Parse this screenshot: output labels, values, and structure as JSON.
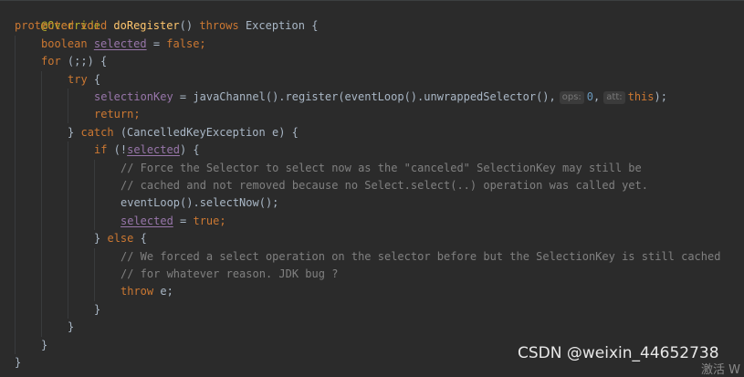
{
  "code": {
    "annotation": "@Override",
    "kw_protected": "protected",
    "kw_void": "void",
    "method_name": "doRegister",
    "paren_open_close": "()",
    "kw_throws": "throws",
    "exception_type": "Exception",
    "brace_open": "{",
    "kw_boolean": "boolean",
    "var_selected": "selected",
    "eq": " = ",
    "kw_false": "false",
    "semi": ";",
    "kw_for": "for",
    "for_header": " (;;) {",
    "kw_try": "try",
    "field_selectionKey": "selectionKey",
    "register_call": "javaChannel().register(eventLoop().unwrappedSelector(),",
    "hint_ops": "ops:",
    "num_zero": "0",
    "comma": ",",
    "hint_att": "att:",
    "kw_this": "this",
    "close_paren_semi": ");",
    "kw_return": "return",
    "brace_close": "}",
    "kw_catch": "catch",
    "catch_param": " (CancelledKeyException e) {",
    "kw_if": "if",
    "if_open": " (!",
    "if_close": ") {",
    "comment_1": "// Force the Selector to select now as the \"canceled\" SelectionKey may still be",
    "comment_2": "// cached and not removed because no Select.select(..) operation was called yet.",
    "select_now": "eventLoop().selectNow();",
    "kw_true": "true",
    "kw_else": "else",
    "comment_3": "// We forced a select operation on the selector before but the SelectionKey is still cached",
    "comment_4": "// for whatever reason. JDK bug ?",
    "kw_throw": "throw",
    "throw_var": " e;"
  },
  "overlay": {
    "watermark": "CSDN @weixin_44652738",
    "activate": "激活 W"
  }
}
